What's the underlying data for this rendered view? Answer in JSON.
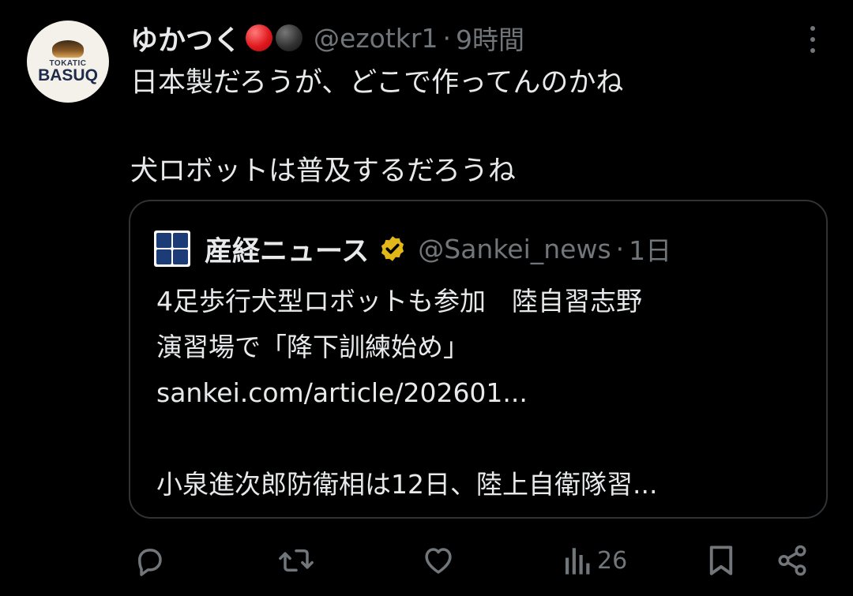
{
  "author": {
    "display_name": "ゆかつく",
    "handle": "@ezotkr1",
    "separator": "·",
    "time": "9時間",
    "avatar_text_small": "TOKATIC",
    "avatar_text_big": "BASUQ",
    "emoji": [
      "red-circle",
      "black-circle"
    ]
  },
  "post": {
    "line1": "日本製だろうが、どこで作ってんのかね",
    "line2": "犬ロボットは普及するだろうね"
  },
  "quote": {
    "display_name": "産経ニュース",
    "handle": "@Sankei_news",
    "separator": "·",
    "time": "1日",
    "verified_color": "#e2b719",
    "lines": [
      "4足歩行犬型ロボットも参加　陸自習志野",
      "演習場で「降下訓練始め」",
      "sankei.com/article/202601...",
      "小泉進次郎防衛相は12日、陸上自衛隊習..."
    ]
  },
  "actions": {
    "views_count": "26",
    "icons": [
      "reply-icon",
      "repost-icon",
      "like-icon",
      "views-icon",
      "bookmark-icon",
      "share-icon"
    ]
  },
  "colors": {
    "background": "#000000",
    "text": "#e7e9ea",
    "muted": "#71767b",
    "border": "#2f3336"
  }
}
